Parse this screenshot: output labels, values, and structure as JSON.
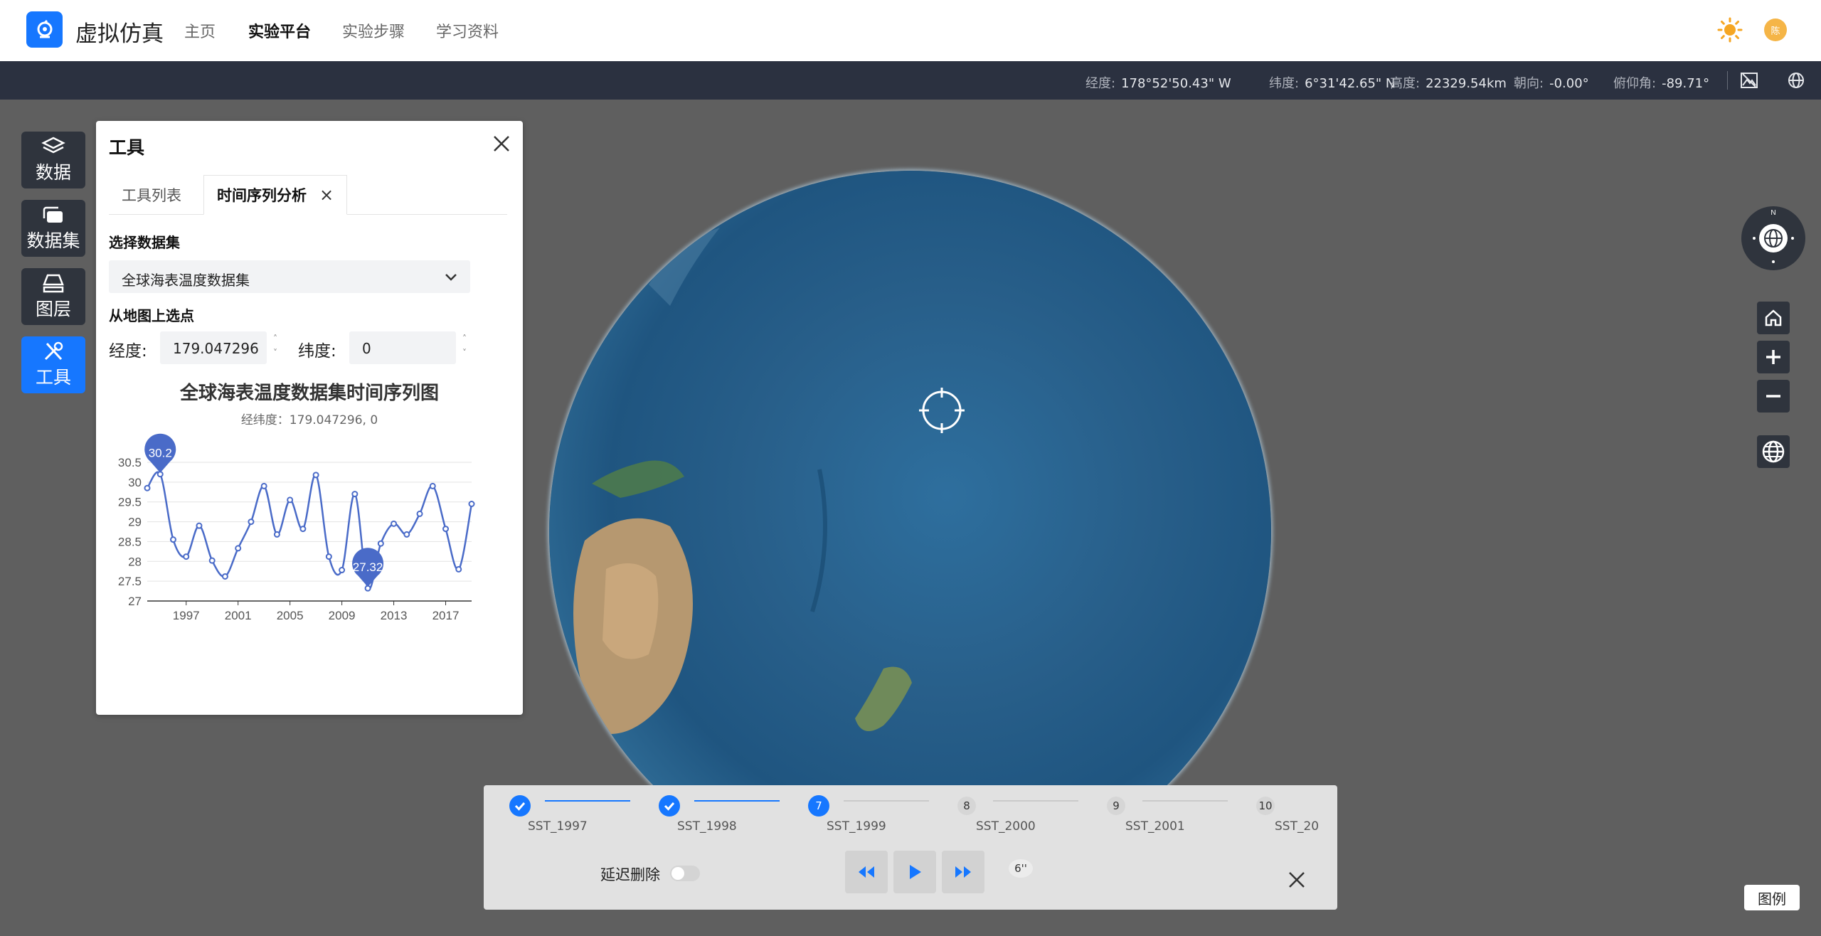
{
  "app": {
    "title": "虚拟仿真"
  },
  "nav": {
    "items": [
      "主页",
      "实验平台",
      "实验步骤",
      "学习资料"
    ],
    "active_index": 1
  },
  "user": {
    "avatar_text": "陈"
  },
  "status": {
    "lon_label": "经度:",
    "lon_value": "178°52'50.43\" W",
    "lat_label": "纬度:",
    "lat_value": "6°31'42.65\" N",
    "alt_label": "高度:",
    "alt_value": "22329.54km",
    "heading_label": "朝向:",
    "heading_value": "-0.00°",
    "pitch_label": "俯仰角:",
    "pitch_value": "-89.71°"
  },
  "dock": {
    "items": [
      "数据",
      "数据集",
      "图层",
      "工具"
    ],
    "active_index": 3
  },
  "tool_panel": {
    "title": "工具",
    "tabs": [
      "工具列表",
      "时间序列分析"
    ],
    "active_tab": 1,
    "dataset_label": "选择数据集",
    "dataset_value": "全球海表温度数据集",
    "pick_label": "从地图上选点",
    "lon_label": "经度:",
    "lon_value": "179.047296",
    "lat_label": "纬度:",
    "lat_value": "0"
  },
  "chart_data": {
    "type": "line",
    "title": "全球海表温度数据集时间序列图",
    "subtitle": "经纬度：179.047296, 0",
    "x": [
      1994,
      1995,
      1996,
      1997,
      1998,
      1999,
      2000,
      2001,
      2002,
      2003,
      2004,
      2005,
      2006,
      2007,
      2008,
      2009,
      2010,
      2011,
      2012,
      2013,
      2014,
      2015,
      2016,
      2017,
      2018,
      2019
    ],
    "xticks": [
      1997,
      2001,
      2005,
      2009,
      2013,
      2017
    ],
    "series": [
      {
        "values": [
          29.85,
          30.2,
          28.55,
          28.12,
          28.9,
          28.02,
          27.62,
          28.33,
          29.0,
          29.9,
          28.68,
          29.55,
          28.82,
          30.18,
          28.12,
          27.78,
          29.7,
          27.32,
          28.45,
          28.95,
          28.68,
          29.2,
          29.9,
          28.82,
          27.8,
          29.45
        ]
      }
    ],
    "ylim": [
      27,
      30.5
    ],
    "yticks": [
      27,
      27.5,
      28,
      28.5,
      29,
      29.5,
      30,
      30.5
    ],
    "markers": [
      {
        "label": "30.2",
        "x": 1995,
        "y": 30.2
      },
      {
        "label": "27.32",
        "x": 2011,
        "y": 27.32
      }
    ],
    "color": "#4a6bc8"
  },
  "timeline": {
    "steps": [
      {
        "num": "1",
        "label": "SST_1997",
        "state": "done"
      },
      {
        "num": "2",
        "label": "SST_1998",
        "state": "done"
      },
      {
        "num": "7",
        "label": "SST_1999",
        "state": "current"
      },
      {
        "num": "8",
        "label": "SST_2000",
        "state": "todo"
      },
      {
        "num": "9",
        "label": "SST_2001",
        "state": "todo"
      },
      {
        "num": "10",
        "label": "SST_20",
        "state": "todo"
      }
    ],
    "delay_label": "延迟删除",
    "speed": "6''"
  },
  "legend_label": "图例",
  "colors": {
    "accent": "#1677ff",
    "dock": "#2f343d",
    "statusbar": "#2b3140"
  }
}
